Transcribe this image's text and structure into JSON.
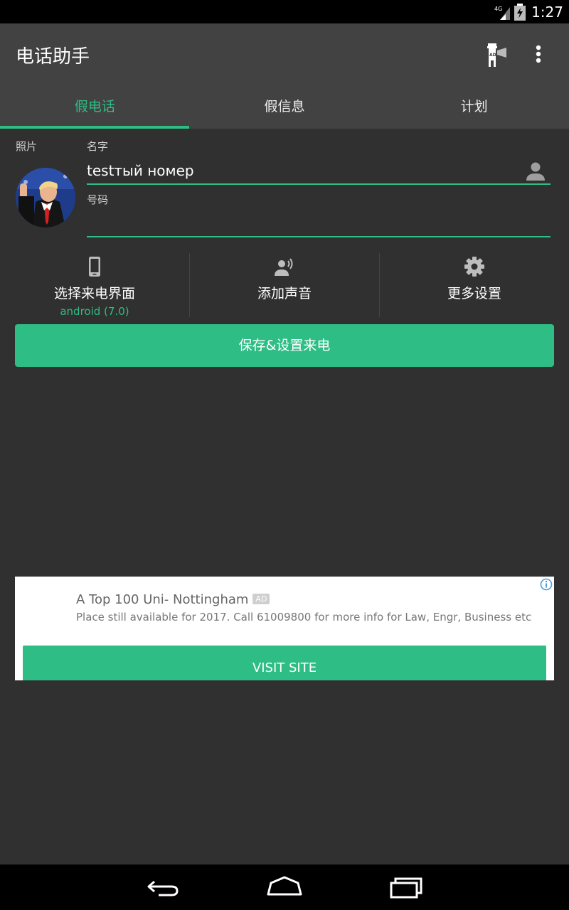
{
  "status_bar": {
    "network": "4G",
    "time": "1:27"
  },
  "app_bar": {
    "title": "电话助手",
    "ad_icon_text": "AD"
  },
  "tabs": [
    {
      "label": "假电话",
      "active": true
    },
    {
      "label": "假信息",
      "active": false
    },
    {
      "label": "计划",
      "active": false
    }
  ],
  "form": {
    "photo_label": "照片",
    "name_label": "名字",
    "name_value": "testтый номер",
    "number_label": "号码",
    "number_value": ""
  },
  "options": [
    {
      "label": "选择来电界面",
      "sub": "android (7.0)",
      "icon": "phone-icon"
    },
    {
      "label": "添加声音",
      "sub": "",
      "icon": "voice-icon"
    },
    {
      "label": "更多设置",
      "sub": "",
      "icon": "gear-icon"
    }
  ],
  "save_button": "保存&设置来电",
  "ad": {
    "title": "A Top 100 Uni- Nottingham",
    "badge": "AD",
    "description": "Place still available for 2017. Call 61009800 for more info for Law, Engr, Business etc",
    "cta": "VISIT SITE"
  },
  "colors": {
    "accent": "#2ebd85",
    "background": "#303030",
    "app_bar": "#424242"
  }
}
